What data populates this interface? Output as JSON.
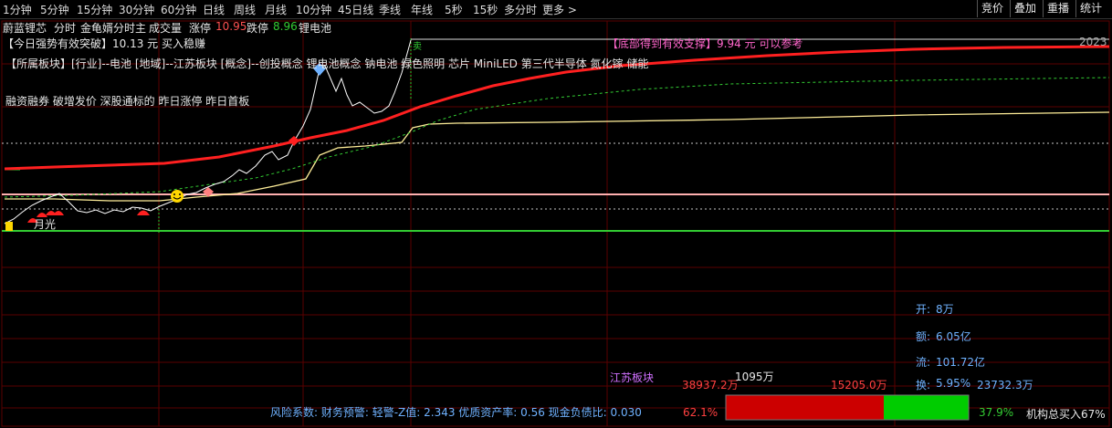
{
  "toolbar": {
    "periods": [
      "1分钟",
      "5分钟",
      "15分钟",
      "30分钟",
      "60分钟",
      "日线",
      "周线",
      "月线",
      "10分钟",
      "45日线",
      "季线",
      "年线",
      "5秒",
      "15秒",
      "多分时",
      "更多 >"
    ],
    "right_buttons": [
      "竞价",
      "叠加",
      "重播",
      "统计"
    ]
  },
  "stock_header": {
    "name": "蔚蓝锂芯",
    "tabs": [
      "分时",
      "金龟婿分时主",
      "成交量"
    ],
    "limit_up_label": "涨停",
    "limit_up_value": "10.95",
    "limit_down_label": "跌停",
    "limit_down_value": "8.96",
    "concept": "锂电池"
  },
  "annotations": {
    "breakout_signal": "【今日强势有效突破】10.13 元 买入稳赚",
    "support_signal": "【底部得到有效支撑】9.94 元 可以参考",
    "year_label": "2023",
    "sectors": "【所属板块】[行业]--电池 [地域]--江苏板块 [概念]--创投概念 锂电池概念 钠电池 绿色照明 芯片 MiniLED 第三代半导体 氮化镓 储能",
    "margin_info": "融资融券 破增发价 深股通标的 昨日涨停 昨日首板",
    "sell_marker": "卖",
    "moon_label": "月光"
  },
  "stats": {
    "open_label": "开:",
    "open_value": "8万",
    "amount_label": "额:",
    "amount_value": "6.05亿",
    "float_label": "流:",
    "float_value": "101.72亿",
    "turnover_label": "换:",
    "turnover_pct": "5.95%",
    "turnover_amount": "23732.3万"
  },
  "volume_bar": {
    "sector_label": "江苏板块",
    "left_amount": "38937.2万",
    "mid_amount": "1095万",
    "right_amount": "15205.0万",
    "left_pct": "62.1%",
    "right_pct": "37.9%",
    "buy_ratio": 0.621,
    "institution": "机构总买入67%"
  },
  "risk_bar": {
    "text": "风险系数: 财务预警: 轻警-Z值: 2.343 优质资产率: 0.56 现金负债比: 0.030"
  },
  "colors": {
    "red_line": "#ff2020",
    "price_line": "#ffffff",
    "avg_line": "#ffee99",
    "green": "#33cc33",
    "grid": "#5a0000",
    "accent_blue": "#6fb2ff"
  }
}
